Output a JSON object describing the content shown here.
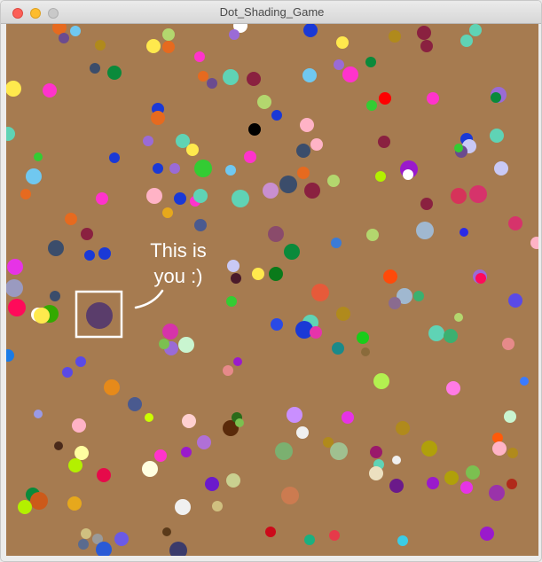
{
  "window": {
    "title": "Dot_Shading_Game",
    "controls": [
      "close",
      "minimize",
      "zoom"
    ]
  },
  "game": {
    "background_color": "#a67b50",
    "player": {
      "color": "#5a3d6b",
      "selection_box_color": "#ffffff",
      "label_line1": "This is",
      "label_line2": "you :)"
    },
    "dots_color_palette": [
      "#ff0000",
      "#1a39d6",
      "#ff33cc",
      "#33cc33",
      "#ffb3c6",
      "#5fd3b5",
      "#ffe94d",
      "#6b4b8f",
      "#e66a1f",
      "#8a2140",
      "#b3d76e",
      "#ffffff",
      "#3b4d6b",
      "#c9c9f5",
      "#9a6bd6",
      "#0a8a3b",
      "#b08a1c",
      "#70c8f0"
    ]
  }
}
